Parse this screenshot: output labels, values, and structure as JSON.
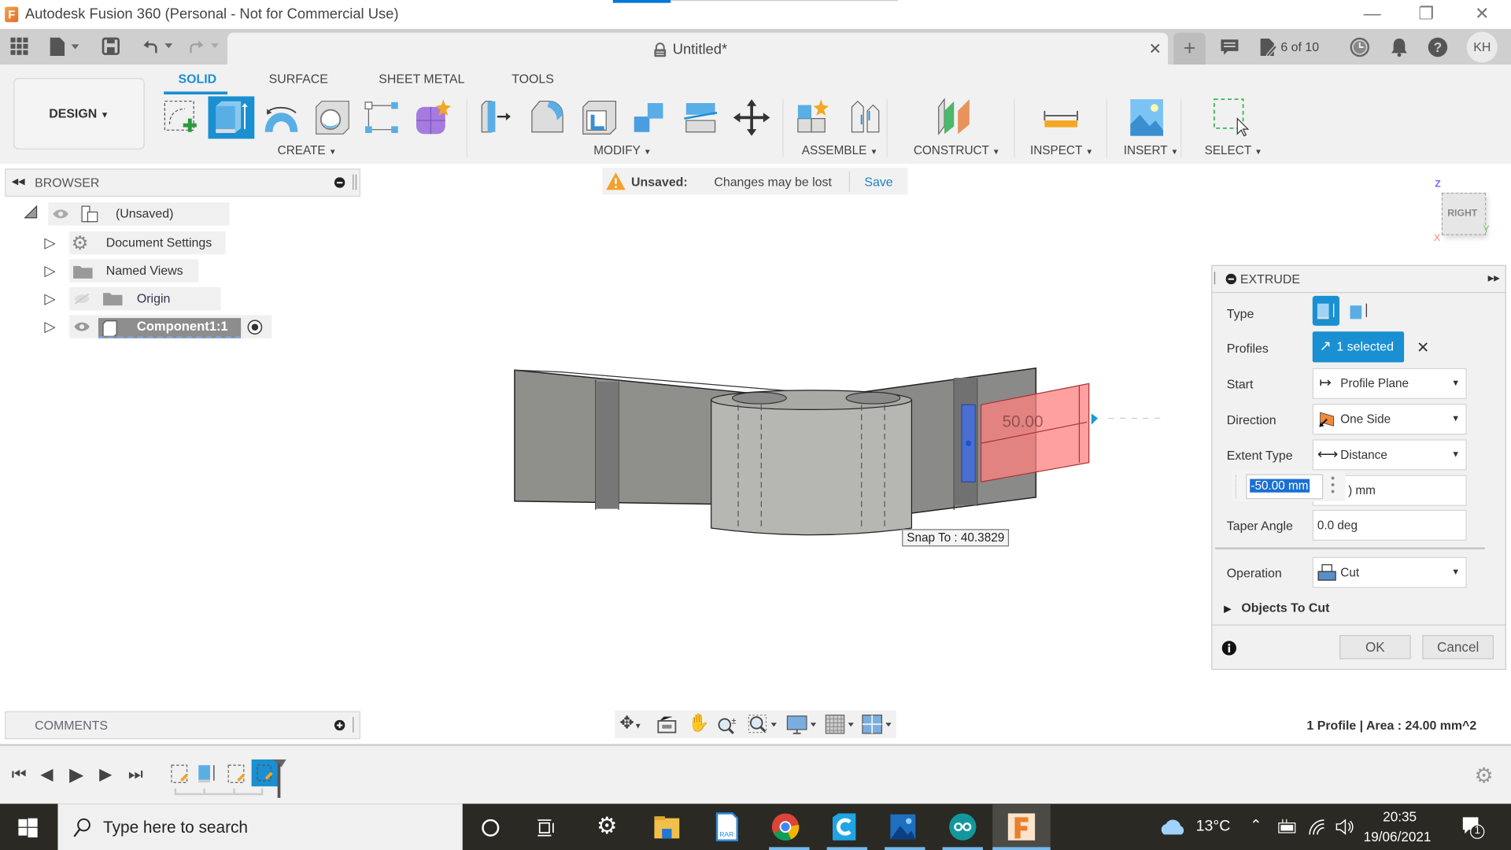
{
  "window": {
    "app_title": "Autodesk Fusion 360 (Personal - Not for Commercial Use)",
    "app_logo_letter": "F",
    "minimize_icon": "minimize-icon",
    "restore_icon": "restore-icon",
    "close_icon": "close-icon"
  },
  "appbar": {
    "document_title": "Untitled*",
    "version_label": "6 of 10",
    "user_initials": "KH"
  },
  "toolbar": {
    "workspace_label": "DESIGN",
    "tabs": [
      {
        "label": "SOLID",
        "active": true
      },
      {
        "label": "SURFACE",
        "active": false
      },
      {
        "label": "SHEET METAL",
        "active": false
      },
      {
        "label": "TOOLS",
        "active": false
      }
    ],
    "groups": {
      "create": "CREATE",
      "modify": "MODIFY",
      "assemble": "ASSEMBLE",
      "construct": "CONSTRUCT",
      "inspect": "INSPECT",
      "insert": "INSERT",
      "select": "SELECT"
    }
  },
  "browser": {
    "title": "BROWSER",
    "items": [
      {
        "label": "(Unsaved)",
        "icon": "component-icon"
      },
      {
        "label": "Document Settings",
        "icon": "gear-icon"
      },
      {
        "label": "Named Views",
        "icon": "folder-icon"
      },
      {
        "label": "Origin",
        "icon": "folder-icon"
      },
      {
        "label": "Component1:1",
        "icon": "body-icon"
      }
    ]
  },
  "notification": {
    "title": "Unsaved:",
    "message": "Changes may be lost",
    "action": "Save"
  },
  "viewcube": {
    "face": "RIGHT",
    "axis_z": "Z",
    "axis_y": "Y",
    "axis_x": "X"
  },
  "viewport": {
    "dimension_label": "50.00",
    "snap_tooltip": "Snap To : 40.3829"
  },
  "extrude": {
    "title": "EXTRUDE",
    "type_label": "Type",
    "profiles_label": "Profiles",
    "profiles_value": "1 selected",
    "start_label": "Start",
    "start_value": "Profile Plane",
    "direction_label": "Direction",
    "direction_value": "One Side",
    "extent_label": "Extent Type",
    "extent_value": "Distance",
    "distance_value": "-50.00 mm",
    "distance_field_behind": ") mm",
    "taper_label": "Taper Angle",
    "taper_value": "0.0 deg",
    "operation_label": "Operation",
    "operation_value": "Cut",
    "objects_to_cut_label": "Objects To Cut",
    "ok_label": "OK",
    "cancel_label": "Cancel"
  },
  "comments": {
    "title": "COMMENTS"
  },
  "status": {
    "profile_info": "1 Profile | Area : 24.00 mm^2"
  },
  "taskbar": {
    "search_placeholder": "Type here to search",
    "weather": "13°C",
    "time": "20:35",
    "date": "19/06/2021",
    "notifications_count": "1"
  }
}
